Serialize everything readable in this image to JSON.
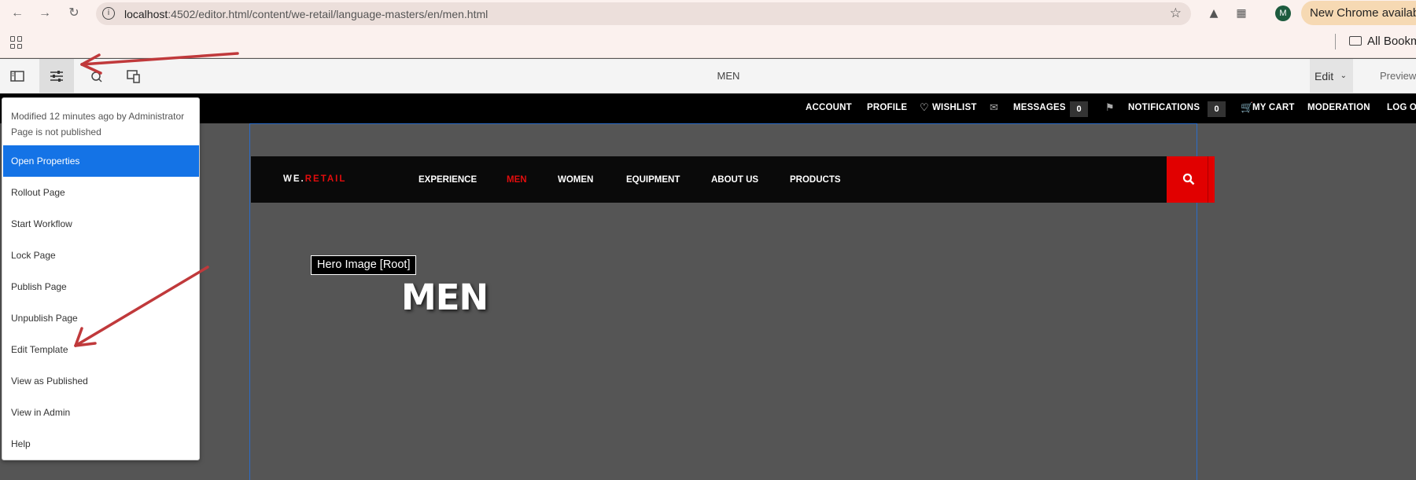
{
  "browser": {
    "url_host": "localhost",
    "url_path": ":4502/editor.html/content/we-retail/language-masters/en/men.html",
    "avatar_letter": "M",
    "update_pill": "New Chrome available",
    "bookmarks_folder": "All Bookmarks"
  },
  "editor": {
    "page_title": "MEN",
    "mode_select": "Edit",
    "preview_label": "Preview"
  },
  "site_top_nav": {
    "account": "ACCOUNT",
    "profile": "PROFILE",
    "wishlist": "WISHLIST",
    "messages": "MESSAGES",
    "messages_count": "0",
    "notifications": "NOTIFICATIONS",
    "notifications_count": "0",
    "cart": "MY CART",
    "moderation": "MODERATION",
    "logout": "LOG OUT"
  },
  "site_nav": {
    "logo_white": "WE.",
    "logo_red": "RETAIL",
    "items": [
      {
        "label": "EXPERIENCE"
      },
      {
        "label": "MEN"
      },
      {
        "label": "WOMEN"
      },
      {
        "label": "EQUIPMENT"
      },
      {
        "label": "ABOUT US"
      },
      {
        "label": "PRODUCTS"
      }
    ]
  },
  "hero": {
    "component_label": "Hero Image [Root]",
    "title": "MEN"
  },
  "page_info_menu": {
    "modified_text": "Modified 12 minutes ago by Administrator",
    "status_text": "Page is not published",
    "items": [
      {
        "label": "Open Properties"
      },
      {
        "label": "Rollout Page"
      },
      {
        "label": "Start Workflow"
      },
      {
        "label": "Lock Page"
      },
      {
        "label": "Publish Page"
      },
      {
        "label": "Unpublish Page"
      },
      {
        "label": "Edit Template"
      },
      {
        "label": "View as Published"
      },
      {
        "label": "View in Admin"
      },
      {
        "label": "Help"
      }
    ]
  },
  "colors": {
    "selected_item": "#1473e6",
    "brand_red": "#e10d0d",
    "annotation_arrow": "#c0393b"
  }
}
